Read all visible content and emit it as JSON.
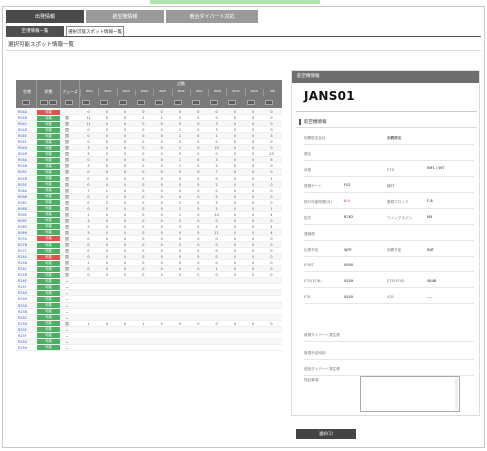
{
  "tabs": [
    "出発情報",
    "航空機情報",
    "競合ダイバート対応"
  ],
  "subtabs": [
    "空港情報一覧",
    "選択可能スポット情報一覧"
  ],
  "page_title": "選択可能スポット情報一覧",
  "table": {
    "headers": {
      "spot": "空港",
      "status": "状態",
      "phase": "フェーズ",
      "group": "点数"
    },
    "subcols": [
      "WG1",
      "WG2",
      "WG3",
      "WG4",
      "WG5",
      "WG6",
      "WG7",
      "WG8",
      "WG9",
      "WG0",
      "WE"
    ],
    "rows": [
      {
        "spot": "R04A",
        "status": "可能",
        "st": "ng",
        "phase": "",
        "v": [
          "0",
          "0",
          "0",
          "0",
          "0",
          "0",
          "0",
          "0",
          "0",
          "0",
          "0"
        ]
      },
      {
        "spot": "R04B",
        "status": "可能",
        "st": "ok",
        "phase": "国",
        "v": [
          "11",
          "0",
          "0",
          "2",
          "1",
          "3",
          "0",
          "0",
          "0",
          "0",
          "0"
        ]
      },
      {
        "spot": "R04C",
        "status": "可能",
        "st": "ok",
        "phase": "国",
        "v": [
          "11",
          "0",
          "0",
          "0",
          "0",
          "0",
          "0",
          "3",
          "0",
          "0",
          "0"
        ]
      },
      {
        "spot": "R04D",
        "status": "可能",
        "st": "ok",
        "phase": "国",
        "v": [
          "0",
          "0",
          "0",
          "0",
          "0",
          "1",
          "0",
          "3",
          "0",
          "0",
          "0"
        ]
      },
      {
        "spot": "R04E",
        "status": "可能",
        "st": "ok",
        "phase": "国",
        "v": [
          "0",
          "0",
          "0",
          "0",
          "0",
          "2",
          "0",
          "1",
          "0",
          "0",
          "3"
        ]
      },
      {
        "spot": "R04F",
        "status": "可能",
        "st": "ok",
        "phase": "国",
        "v": [
          "0",
          "0",
          "0",
          "0",
          "0",
          "2",
          "0",
          "0",
          "0",
          "0",
          "0"
        ]
      },
      {
        "spot": "R04G",
        "status": "可能",
        "st": "ok",
        "phase": "国",
        "v": [
          "3",
          "0",
          "0",
          "0",
          "0",
          "1",
          "0",
          "10",
          "0",
          "0",
          "0"
        ]
      },
      {
        "spot": "R04H",
        "status": "可能",
        "st": "ok",
        "phase": "国",
        "v": [
          "3",
          "0",
          "0",
          "0",
          "0",
          "0",
          "0",
          "0",
          "0",
          "0",
          "23"
        ]
      },
      {
        "spot": "R05A",
        "status": "可能",
        "st": "ok",
        "phase": "国",
        "v": [
          "0",
          "0",
          "0",
          "0",
          "0",
          "1",
          "0",
          "3",
          "0",
          "0",
          "5"
        ]
      },
      {
        "spot": "R05B",
        "status": "可能",
        "st": "ok",
        "phase": "国",
        "v": [
          "3",
          "0",
          "0",
          "0",
          "0",
          "1",
          "0",
          "5",
          "0",
          "0",
          "0"
        ]
      },
      {
        "spot": "R05C",
        "status": "可能",
        "st": "ok",
        "phase": "国",
        "v": [
          "0",
          "0",
          "0",
          "0",
          "0",
          "5",
          "0",
          "7",
          "0",
          "0",
          "0"
        ]
      },
      {
        "spot": "R05D",
        "status": "可能",
        "st": "ok",
        "phase": "国",
        "v": [
          "0",
          "0",
          "0",
          "0",
          "0",
          "0",
          "0",
          "0",
          "0",
          "0",
          "1"
        ]
      },
      {
        "spot": "R05E",
        "status": "可能",
        "st": "ok",
        "phase": "国",
        "v": [
          "0",
          "0",
          "0",
          "0",
          "0",
          "0",
          "0",
          "2",
          "0",
          "0",
          "0"
        ]
      },
      {
        "spot": "R06A",
        "status": "可能",
        "st": "ok",
        "phase": "国",
        "v": [
          "7",
          "1",
          "0",
          "0",
          "0",
          "4",
          "0",
          "0",
          "0",
          "0",
          "0"
        ]
      },
      {
        "spot": "R06B",
        "status": "可能",
        "st": "ok",
        "phase": "国",
        "v": [
          "0",
          "2",
          "0",
          "0",
          "0",
          "0",
          "0",
          "5",
          "0",
          "0",
          "0"
        ]
      },
      {
        "spot": "R06C",
        "status": "可能",
        "st": "ok",
        "phase": "国",
        "v": [
          "0",
          "2",
          "0",
          "0",
          "0",
          "2",
          "0",
          "3",
          "0",
          "0",
          "0"
        ]
      },
      {
        "spot": "R06D",
        "status": "可能",
        "st": "ok",
        "phase": "国",
        "v": [
          "0",
          "0",
          "0",
          "0",
          "0",
          "2",
          "0",
          "2",
          "0",
          "0",
          "1"
        ]
      },
      {
        "spot": "R06E",
        "status": "可能",
        "st": "ok",
        "phase": "国",
        "v": [
          "1",
          "0",
          "0",
          "0",
          "0",
          "1",
          "0",
          "14",
          "0",
          "0",
          "4"
        ]
      },
      {
        "spot": "R06F",
        "status": "可能",
        "st": "ok",
        "phase": "国",
        "v": [
          "3",
          "0",
          "0",
          "0",
          "0",
          "3",
          "0",
          "0",
          "0",
          "0",
          "0"
        ]
      },
      {
        "spot": "R06G",
        "status": "可能",
        "st": "ok",
        "phase": "国",
        "v": [
          "2",
          "0",
          "0",
          "0",
          "0",
          "3",
          "0",
          "4",
          "0",
          "0",
          "4"
        ]
      },
      {
        "spot": "R06H",
        "status": "可能",
        "st": "ok",
        "phase": "国",
        "v": [
          "3",
          "0",
          "0",
          "0",
          "0",
          "4",
          "0",
          "11",
          "0",
          "0",
          "4"
        ]
      },
      {
        "spot": "R07A",
        "status": "可能",
        "st": "ng",
        "phase": "国",
        "v": [
          "0",
          "0",
          "0",
          "0",
          "0",
          "0",
          "0",
          "0",
          "0",
          "0",
          "0"
        ]
      },
      {
        "spot": "R07B",
        "status": "可能",
        "st": "ok",
        "phase": "国",
        "v": [
          "0",
          "0",
          "0",
          "0",
          "0",
          "3",
          "0",
          "0",
          "0",
          "0",
          "0"
        ]
      },
      {
        "spot": "R07C",
        "status": "可能",
        "st": "ok",
        "phase": "国",
        "v": [
          "0",
          "0",
          "0",
          "0",
          "0",
          "0",
          "0",
          "0",
          "0",
          "0",
          "0"
        ]
      },
      {
        "spot": "R24A",
        "status": "可能",
        "st": "ng",
        "phase": "国",
        "v": [
          "0",
          "0",
          "0",
          "0",
          "0",
          "0",
          "0",
          "0",
          "0",
          "0",
          "0"
        ]
      },
      {
        "spot": "R24B",
        "status": "可能",
        "st": "ok",
        "phase": "国",
        "v": [
          "1",
          "0",
          "0",
          "0",
          "0",
          "0",
          "0",
          "0",
          "0",
          "0",
          "0"
        ]
      },
      {
        "spot": "R24C",
        "status": "可能",
        "st": "ok",
        "phase": "国",
        "v": [
          "0",
          "0",
          "0",
          "0",
          "0",
          "0",
          "0",
          "1",
          "0",
          "0",
          "0"
        ]
      },
      {
        "spot": "R24D",
        "status": "可能",
        "st": "ok",
        "phase": "国",
        "v": [
          "0",
          "0",
          "0",
          "0",
          "0",
          "0",
          "0",
          "0",
          "0",
          "0",
          "0"
        ]
      },
      {
        "spot": "R24E",
        "status": "可能",
        "st": "ok",
        "phase": "—",
        "v": [
          "",
          "",
          "",
          "",
          "",
          "",
          "",
          "",
          "",
          "",
          ""
        ]
      },
      {
        "spot": "R24F",
        "status": "可能",
        "st": "ok",
        "phase": "—",
        "v": [
          "",
          "",
          "",
          "",
          "",
          "",
          "",
          "",
          "",
          "",
          ""
        ]
      },
      {
        "spot": "R24G",
        "status": "可能",
        "st": "ok",
        "phase": "—",
        "v": [
          "",
          "",
          "",
          "",
          "",
          "",
          "",
          "",
          "",
          "",
          ""
        ]
      },
      {
        "spot": "R24H",
        "status": "可能",
        "st": "ok",
        "phase": "—",
        "v": [
          "",
          "",
          "",
          "",
          "",
          "",
          "",
          "",
          "",
          "",
          ""
        ]
      },
      {
        "spot": "R25A",
        "status": "可能",
        "st": "ok",
        "phase": "—",
        "v": [
          "",
          "",
          "",
          "",
          "",
          "",
          "",
          "",
          "",
          "",
          ""
        ]
      },
      {
        "spot": "R25B",
        "status": "可能",
        "st": "ok",
        "phase": "—",
        "v": [
          "",
          "",
          "",
          "",
          "",
          "",
          "",
          "",
          "",
          "",
          ""
        ]
      },
      {
        "spot": "R25C",
        "status": "可能",
        "st": "ok",
        "phase": "—",
        "v": [
          "",
          "",
          "",
          "",
          "",
          "",
          "",
          "",
          "",
          "",
          ""
        ]
      },
      {
        "spot": "R25D",
        "status": "可能",
        "st": "ok",
        "phase": "国",
        "v": [
          "1",
          "0",
          "0",
          "1",
          "0",
          "0",
          "0",
          "0",
          "0",
          "0",
          "0"
        ]
      },
      {
        "spot": "R25E",
        "status": "可能",
        "st": "ok",
        "phase": "—",
        "v": [
          "",
          "",
          "",
          "",
          "",
          "",
          "",
          "",
          "",
          "",
          ""
        ]
      },
      {
        "spot": "R25F",
        "status": "可能",
        "st": "ok",
        "phase": "—",
        "v": [
          "",
          "",
          "",
          "",
          "",
          "",
          "",
          "",
          "",
          "",
          ""
        ]
      },
      {
        "spot": "R25G",
        "status": "可能",
        "st": "ok",
        "phase": "—",
        "v": [
          "",
          "",
          "",
          "",
          "",
          "",
          "",
          "",
          "",
          "",
          ""
        ]
      },
      {
        "spot": "R25H",
        "status": "可能",
        "st": "ok",
        "phase": "—",
        "v": [
          "",
          "",
          "",
          "",
          "",
          "",
          "",
          "",
          "",
          "",
          ""
        ]
      }
    ]
  },
  "panel": {
    "header": "航空機情報",
    "flight_no": "JANS01",
    "section": "航空機情報",
    "fields": {
      "l1": "到着航空会社",
      "v1": "到着便名",
      "l2": "便名",
      "l3": "状態",
      "l3b": "ETD",
      "v3b": "INFL / INT",
      "l4": "搭乗ゲート",
      "v4": "F02",
      "l4b": "機材",
      "v4b": "",
      "l5": "飛行可能時間(分)",
      "v5": "8.9",
      "l5b": "登録ブロック",
      "v5b": "F-8",
      "l6": "型式",
      "v6": "B762",
      "l6b": "ウイングスパン",
      "v6b": "M4",
      "l7": "連絡便",
      "l8": "出発予定",
      "v8": "SJFE",
      "l8b": "到着予定",
      "v8b": "INJT",
      "l9": "EOBT",
      "v9": "0900",
      "l10": "ETD(EOB)",
      "v10": "0509",
      "l10b": "ETD(EOB)",
      "v10b": "0848",
      "l11": "ETA",
      "v11": "0505",
      "l11b": "ATA",
      "v11b": "----",
      "l12": "新規ダイバート発生便",
      "l13": "新規予定時刻",
      "l14": "前回ダイバート発生便",
      "l15": "特記事項"
    },
    "register_button": "選択(1)"
  }
}
